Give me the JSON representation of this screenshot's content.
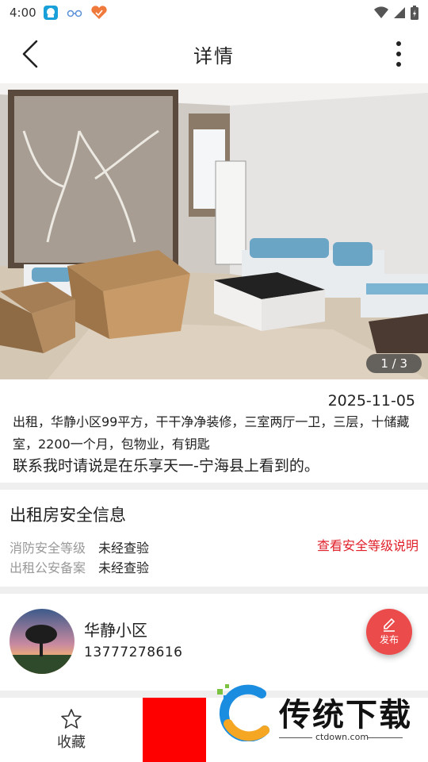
{
  "status_bar": {
    "time": "4:00"
  },
  "header": {
    "title": "详情"
  },
  "photo": {
    "counter": "1 / 3"
  },
  "listing": {
    "date": "2025-11-05",
    "description": "出租，华静小区99平方，干干净净装修，三室两厅一卫，三层，十储藏室，2200一个月，包物业，有钥匙",
    "contact_note": "联系我时请说是在乐享天一-宁海县上看到的。"
  },
  "safety": {
    "title": "出租房安全信息",
    "rows": [
      {
        "key": "消防安全等级",
        "value": "未经查验"
      },
      {
        "key": "出租公安备案",
        "value": "未经查验"
      }
    ],
    "link": "查看安全等级说明"
  },
  "owner": {
    "name": "华静小区",
    "phone": "13777278616"
  },
  "publish_button": {
    "label": "发布"
  },
  "bottom_bar": {
    "favorite_label": "收藏"
  },
  "watermark": {
    "brand": "传统下载",
    "url": "ctdown.com"
  },
  "colors": {
    "accent_red": "#e0202a",
    "publish_red": "#ec4b4b",
    "block_red": "#ff0000"
  }
}
